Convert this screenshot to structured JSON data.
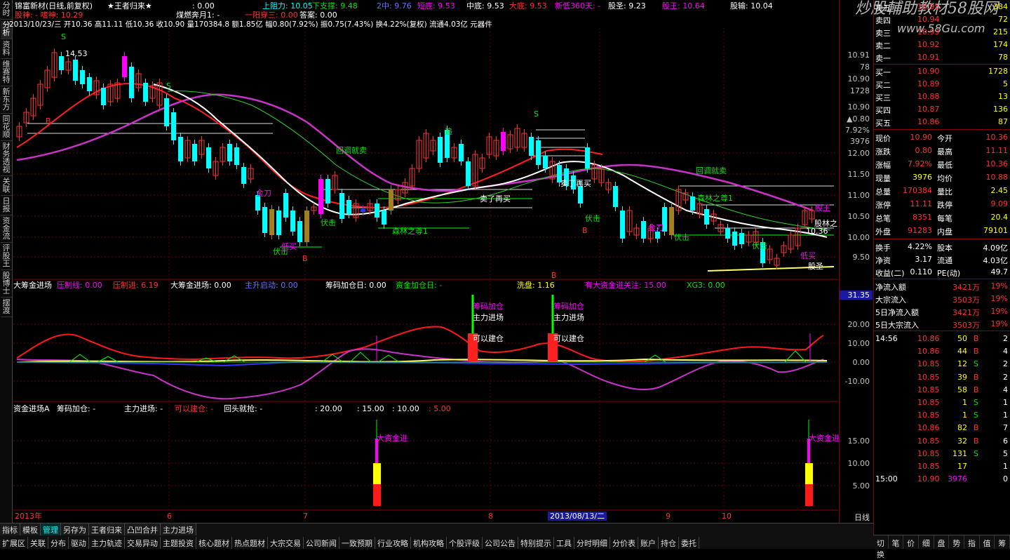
{
  "left_tabs": [
    "分时",
    "分析",
    "资料",
    "维赛特",
    "新东方",
    "同花顺",
    "财务透视",
    "关联",
    "日报",
    "资金流",
    "评股王",
    "股博士",
    "摆渡"
  ],
  "header": {
    "name": "锦富新材(日线,前复权)",
    "formula": "★王者归来★",
    "f0": ": 0.00",
    "res": "上阻力: 10.05",
    "sup": "下支撑: 9.48",
    "mid2": "2中: 9.76",
    "ya": "短底: 9.53",
    "mid": "中底: 9.53",
    "bd": "大底: 9.53",
    "xg": "新低360天: -",
    "gs": "股圣: 9.23",
    "gw": "股王: 10.64",
    "gy": "股输: 10.04",
    "l2a": "股神: - 嗜神: 10.29",
    "l2b": "煤燃奔月1: -",
    "l2c": "一阳穿三: 0.00",
    "l2d": "答案: 0.00",
    "info": "2013/10/23/三 开10.36 高11.11 低10.36 收10.90 量170384.8 额1.85亿 幅0.80(7.92%) 振0.75(7.43%) 换4.22%(复权) 流通4.03亿 元器件"
  },
  "chart_labels": {
    "s1": "S",
    "s2": "S",
    "s3": "S",
    "b1": "B",
    "b2": "B",
    "b3": "B",
    "b4": "B",
    "p1": "14.53",
    "p2": "10.36",
    "a1": "回调就卖",
    "a2": "回调就卖",
    "a3": "卖了再买",
    "a4": "卖了再买",
    "a5": "伏击",
    "a6": "伏击",
    "a7": "伏击",
    "a8": "伏击",
    "a9": "伏击",
    "a10": "低买",
    "a11": "低买",
    "a12": "森林之尊1",
    "a13": "森林之尊1",
    "a14": "金刀",
    "a15": "金刀",
    "a16": "股王",
    "a17": "股林之",
    "a18": "股圣",
    "a19": "追",
    "a20": "S",
    "a21": "均兴",
    "a22": "10.36"
  },
  "price_axis": [
    "12.00",
    "11.50",
    "11.00",
    "10.50",
    "10.00",
    "9.50"
  ],
  "panel2": {
    "t1": "大筹金进场",
    "t2": "压制线: 0.00",
    "t3": "压制进: 6.19",
    "t4": "大筹金进场: 0.00",
    "t5": "主升启动: 0.00",
    "t6": "筹码加仓日: 0.00",
    "t7": "资金加仓日: -",
    "t8": "洗盘: 1.16",
    "t9": "有大资金进关注: 15.00",
    "t10": "XG3: 0.00",
    "lab1": "筹码加仓",
    "lab2": "主力进场",
    "lab3": "可以建仓",
    "lab4": "筹码加仓",
    "lab5": "主力进场",
    "lab6": "可以建仓",
    "axis": [
      "20.00",
      "10.00",
      "0.00",
      "-10.00"
    ],
    "val": "31.35"
  },
  "panel3": {
    "t1": "资金进场A",
    "t2": "筹码加仓: -",
    "t3": "主力进场: -",
    "t4": "可以建仓: -",
    "t5": "回头就抢: -",
    "t6": ": 20.00",
    "t7": ": 15.00",
    "t8": ": 10.00",
    "t9": ": 5.00",
    "lab1": "大资金进",
    "lab2": "大资金进",
    "axis": [
      "15.00",
      "10.00",
      "5.00"
    ]
  },
  "dates": [
    "2013年",
    "6",
    "7",
    "8",
    "2013/08/13/二",
    "9",
    "10"
  ],
  "period": "日线",
  "orderbook": {
    "sell": [
      [
        "卖五",
        "10.95",
        "384"
      ],
      [
        "卖四",
        "10.94",
        "72"
      ],
      [
        "卖三",
        "10.93",
        "215"
      ],
      [
        "卖二",
        "10.92",
        "174"
      ],
      [
        "卖一",
        "10.91",
        "78"
      ]
    ],
    "buy": [
      [
        "买一",
        "10.90",
        "1728"
      ],
      [
        "买二",
        "10.89",
        "5"
      ],
      [
        "买三",
        "10.88",
        "13"
      ],
      [
        "买四",
        "10.87",
        "136"
      ],
      [
        "买五",
        "10.86",
        "87"
      ]
    ],
    "side_vals": [
      "10.91",
      "78",
      "10.90",
      "1728",
      "10.90",
      "▲0.80",
      "7.92%",
      "3976"
    ],
    "stats": [
      [
        "现价",
        "10.90",
        "今开",
        "10.36"
      ],
      [
        "涨跌",
        "0.80",
        "最高",
        "11.11"
      ],
      [
        "涨幅",
        "7.92%",
        "最低",
        "10.36"
      ],
      [
        "现量",
        "3976",
        "均价",
        "10.88"
      ],
      [
        "总量",
        "170384",
        "量比",
        "2.45"
      ],
      [
        "涨停",
        "11.11",
        "跌停",
        "9.09"
      ],
      [
        "总笔",
        "8351",
        "每笔",
        "20.4"
      ],
      [
        "外盘",
        "91283",
        "内盘",
        "79101"
      ]
    ],
    "fin": [
      [
        "换手",
        "4.22%",
        "股本",
        "4.09亿"
      ],
      [
        "净资",
        "3.17",
        "流通",
        "4.03亿"
      ],
      [
        "收益(二)",
        "0.110",
        "PE(动)",
        "49.7"
      ]
    ],
    "flow": [
      [
        "净流入额",
        "3421万",
        "19%"
      ],
      [
        "大宗流入",
        "3503万",
        "19%"
      ],
      [
        "5日净流入额",
        "3421万",
        "19%"
      ],
      [
        "5日大宗流入",
        "3503万",
        "19%"
      ]
    ],
    "ticks": [
      [
        "14:56",
        "10.86",
        "50",
        "B",
        "2"
      ],
      [
        "",
        "10.86",
        "44",
        "B",
        "4"
      ],
      [
        "",
        "10.85",
        "12",
        "S",
        "2"
      ],
      [
        "",
        "10.85",
        "39",
        "B",
        "2"
      ],
      [
        "",
        "10.85",
        "58",
        "B",
        "4"
      ],
      [
        "",
        "10.85",
        "1",
        "S",
        "1"
      ],
      [
        "",
        "10.85",
        "1",
        "S",
        "1"
      ],
      [
        "",
        "10.86",
        "82",
        "B",
        "7"
      ],
      [
        "",
        "10.85",
        "32",
        "B",
        "6"
      ],
      [
        "",
        "10.85",
        "131",
        "S",
        "5"
      ],
      [
        "",
        "10.85",
        "17",
        "",
        "1"
      ],
      [
        "15:00",
        "10.90",
        "3976",
        "",
        "0"
      ]
    ]
  },
  "bottom_tabs1": [
    "指标",
    "模板",
    "管理",
    "另存为",
    "王者归来",
    "凸凹合并",
    "主力进场"
  ],
  "bottom_tabs2": [
    "扩展区",
    "关联",
    "分布",
    "驱动",
    "主力轨迹",
    "交易异动",
    "主题投资",
    "核心题材",
    "热点题材",
    "大宗交易",
    "公司新闻",
    "一致预期",
    "行业攻略",
    "机构攻略",
    "个股评级",
    "公司公告",
    "特别提示",
    "工具",
    "分时明细",
    "分价表",
    "账户",
    "持仓",
    "委托"
  ],
  "right_bottom": [
    "切换",
    "笔",
    "价",
    "细",
    "盘",
    "势",
    "指",
    "值",
    "筹"
  ],
  "watermark": "炒股輔助教材58股网",
  "watermark2": "www.58Gu.com"
}
